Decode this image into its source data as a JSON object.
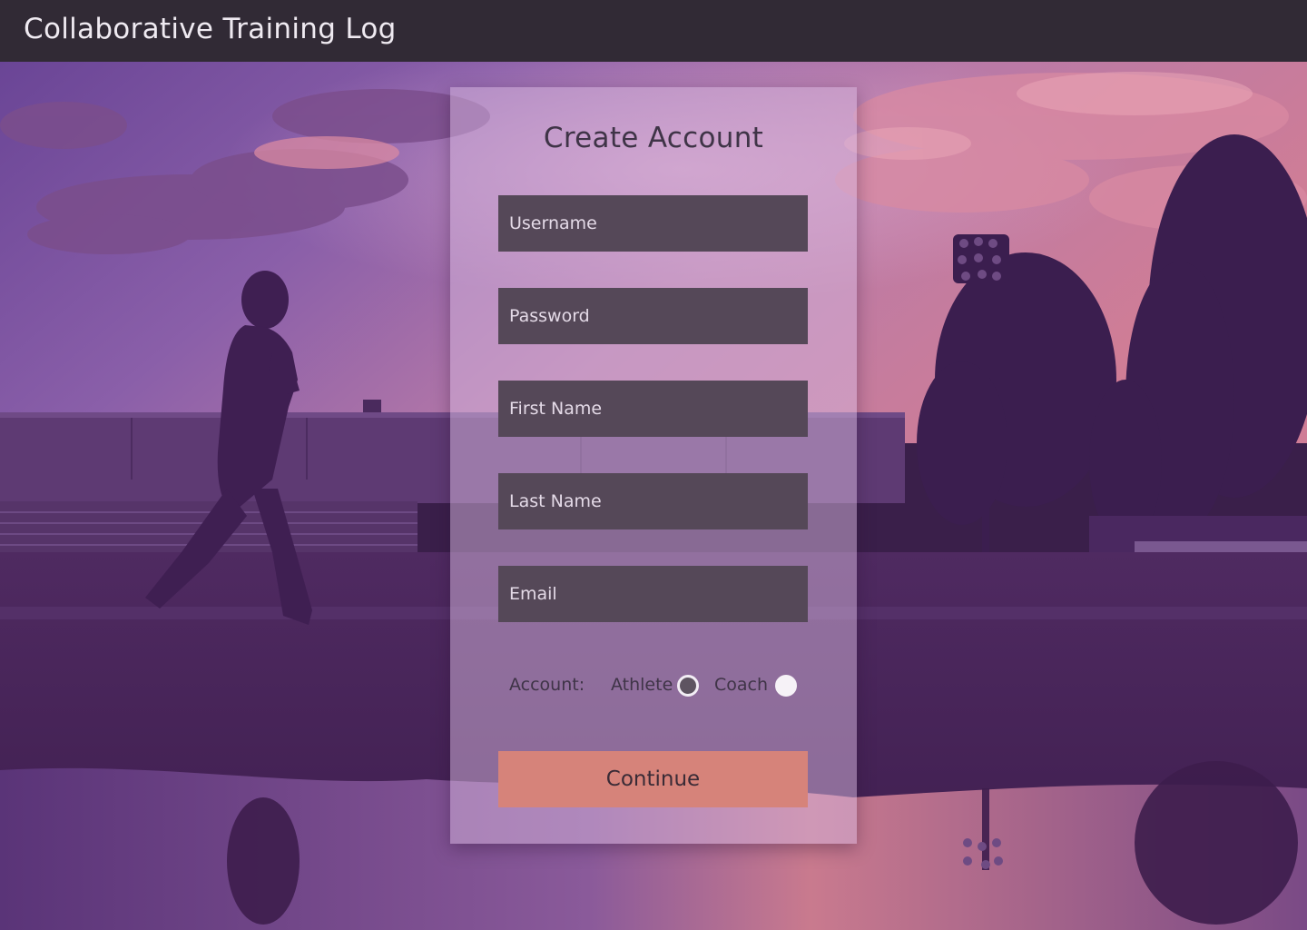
{
  "header": {
    "title": "Collaborative Training Log"
  },
  "form": {
    "title": "Create Account",
    "fields": {
      "username": {
        "placeholder": "Username",
        "value": ""
      },
      "password": {
        "placeholder": "Password",
        "value": ""
      },
      "first_name": {
        "placeholder": "First Name",
        "value": ""
      },
      "last_name": {
        "placeholder": "Last Name",
        "value": ""
      },
      "email": {
        "placeholder": "Email",
        "value": ""
      }
    },
    "account": {
      "label": "Account:",
      "options": [
        {
          "label": "Athlete",
          "selected": true
        },
        {
          "label": "Coach",
          "selected": false
        }
      ]
    },
    "continue_label": "Continue"
  },
  "theme": {
    "header_bg": "#312a35",
    "field_bg": "#554858",
    "button_bg": "#d6837a",
    "overlay_tint": "#5a2b6e"
  }
}
